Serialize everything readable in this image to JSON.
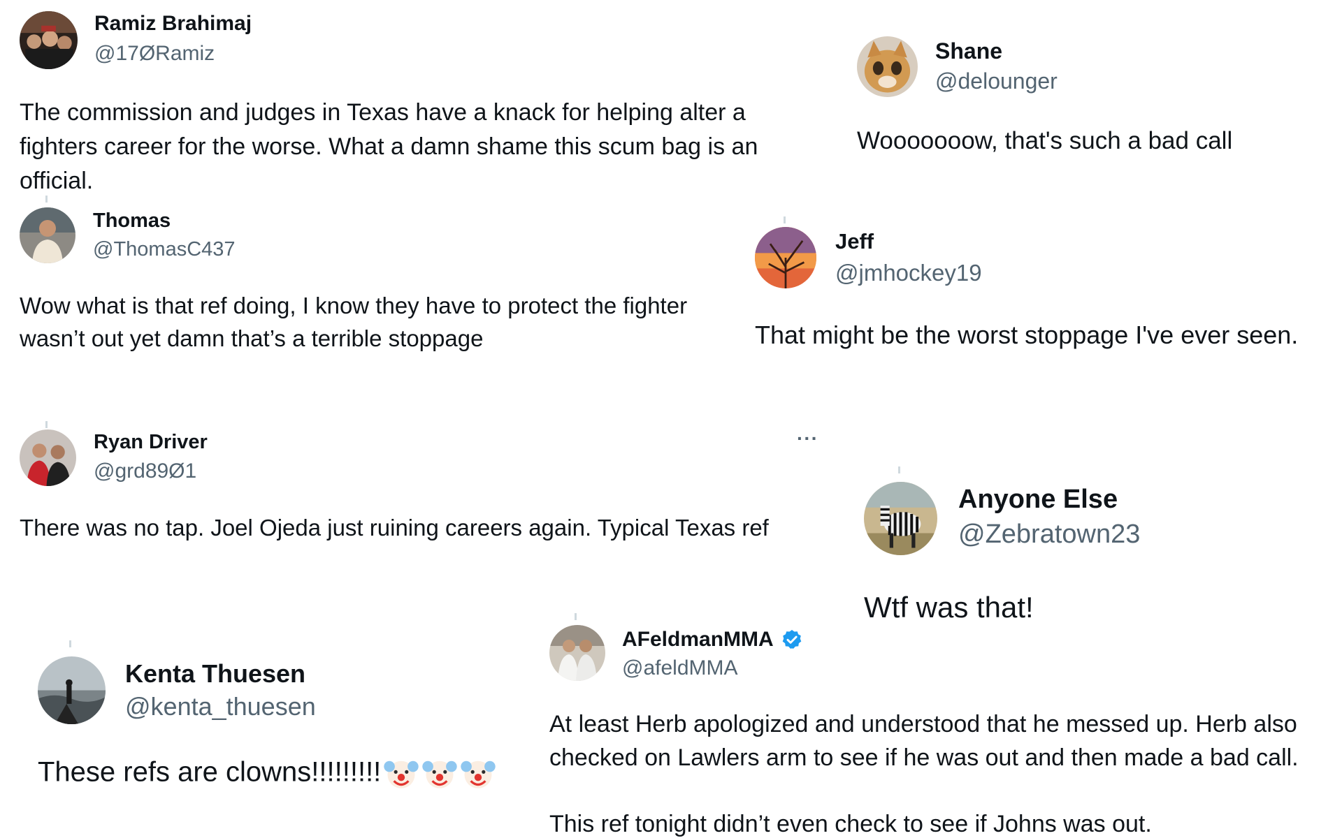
{
  "tweets": [
    {
      "name": "Ramiz Brahimaj",
      "handle": "@17ØRamiz",
      "lines": [
        "The commission and judges in Texas have a knack for helping alter a",
        "fighters career for the worse. What a damn shame this scum bag is an",
        "official."
      ]
    },
    {
      "name": "Shane",
      "handle": "@delounger",
      "lines": [
        "Wooooooow, that's such a bad call"
      ]
    },
    {
      "name": "Thomas",
      "handle": "@ThomasC437",
      "lines": [
        "Wow what is that ref doing, I know they have to protect the fighter",
        "wasn’t out yet damn that’s a terrible stoppage"
      ]
    },
    {
      "name": "Jeff",
      "handle": "@jmhockey19",
      "lines": [
        "That might be the worst stoppage I've ever seen."
      ]
    },
    {
      "name": "Ryan Driver",
      "handle": "@grd89Ø1",
      "more_label": "···",
      "lines": [
        "There was no tap. Joel Ojeda just ruining careers again. Typical Texas ref"
      ]
    },
    {
      "name": "Anyone Else",
      "handle": "@Zebratown23",
      "lines": [
        "Wtf was that!"
      ]
    },
    {
      "name": "Kenta Thuesen",
      "handle": "@kenta_thuesen",
      "lines": [
        "These refs are clowns!!!!!!!!!"
      ],
      "emoji": [
        "clown-face",
        "clown-face",
        "clown-face"
      ]
    },
    {
      "name": "AFeldmanMMA",
      "handle": "@afeldMMA",
      "verified": true,
      "lines": [
        "At least Herb apologized and understood that he messed up. Herb also",
        "checked on Lawlers arm to see if he was out and then made a bad call.",
        "",
        "This ref tonight didn’t even check to see if Johns was out."
      ]
    }
  ],
  "colors": {
    "text": "#0f1419",
    "secondary": "#536471",
    "verified": "#1d9bf0"
  }
}
